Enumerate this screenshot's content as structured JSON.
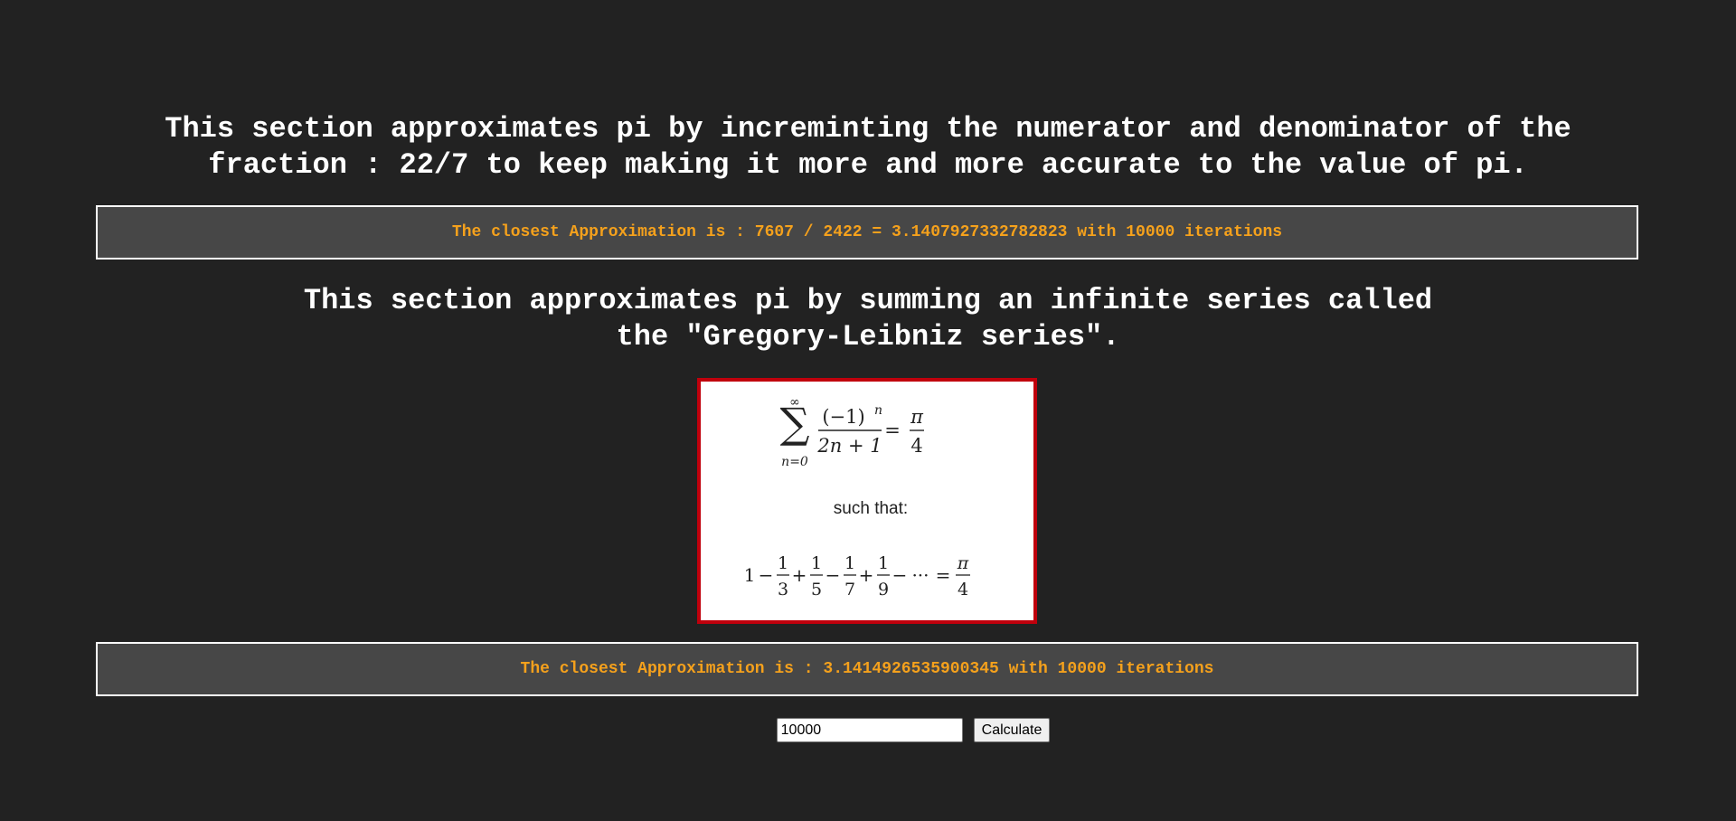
{
  "section1": {
    "heading_line1": "This section approximates pi by increminting the numerator and denominator of the",
    "heading_line2": "fraction : 22/7 to keep making it more and more accurate to the value of pi.",
    "result": "The closest Approximation is : 7607 / 2422 = 3.1407927332782823 with 10000 iterations"
  },
  "section2": {
    "heading_line1": "This section approximates pi by summing an infinite series called",
    "heading_line2": "the \"Gregory-Leibniz series\".",
    "formula": {
      "sum_upper": "∞",
      "sum_lower": "n=0",
      "numerator": "(−1)",
      "exponent": "n",
      "denominator": "2n + 1",
      "equals": "=",
      "pi": "π",
      "four": "4",
      "such_that": "such that:",
      "series_one": "1",
      "series_minus": "−",
      "series_plus": "+",
      "series_ellipsis": "···",
      "series_terms": [
        "3",
        "5",
        "7",
        "9"
      ]
    },
    "result": "The closest Approximation is : 3.1414926535900345 with 10000 iterations"
  },
  "controls": {
    "iterations_value": "10000",
    "calculate_label": "Calculate"
  },
  "colors": {
    "background": "#222222",
    "result_text": "#f5a11c",
    "result_box": "#474747",
    "formula_border": "#c0000c"
  }
}
